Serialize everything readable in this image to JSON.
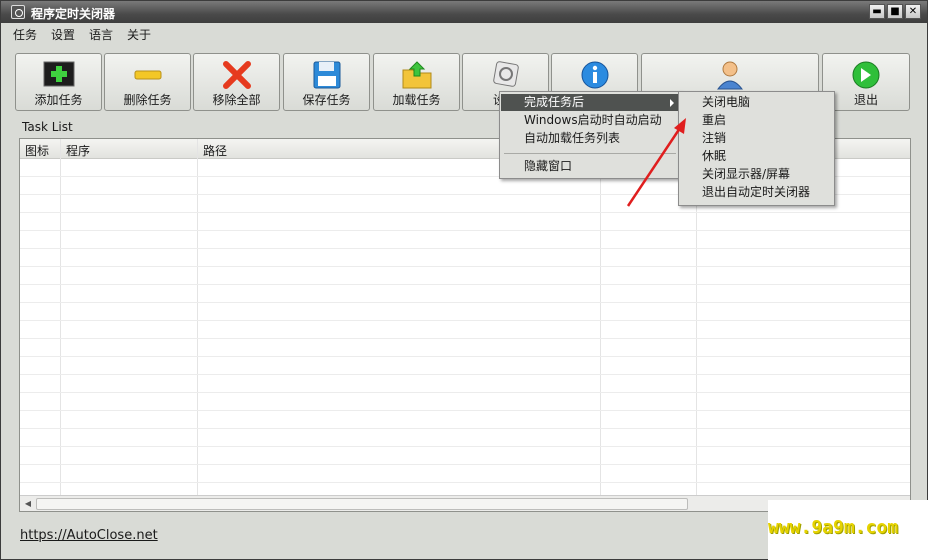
{
  "window": {
    "title": "程序定时关闭器",
    "min": "▬",
    "max": "■",
    "close": "✕"
  },
  "menubar": [
    "任务",
    "设置",
    "语言",
    "关于"
  ],
  "toolbar": {
    "add": "添加任务",
    "delete": "删除任务",
    "remove_all": "移除全部",
    "save": "保存任务",
    "load": "加载任务",
    "settings_partial": "设",
    "exit": "退出"
  },
  "task_list": {
    "label": "Task List",
    "columns": [
      "图标",
      "程序",
      "路径"
    ]
  },
  "settings_menu": {
    "items": [
      "完成任务后",
      "Windows启动时自动启动",
      "自动加载任务列表",
      "隐藏窗口"
    ]
  },
  "submenu": {
    "items": [
      "关闭电脑",
      "重启",
      "注销",
      "休眠",
      "关闭显示器/屏幕",
      "退出自动定时关闭器"
    ]
  },
  "footer_link": "https://AutoClose.net",
  "watermark": "www.9a9m.com"
}
